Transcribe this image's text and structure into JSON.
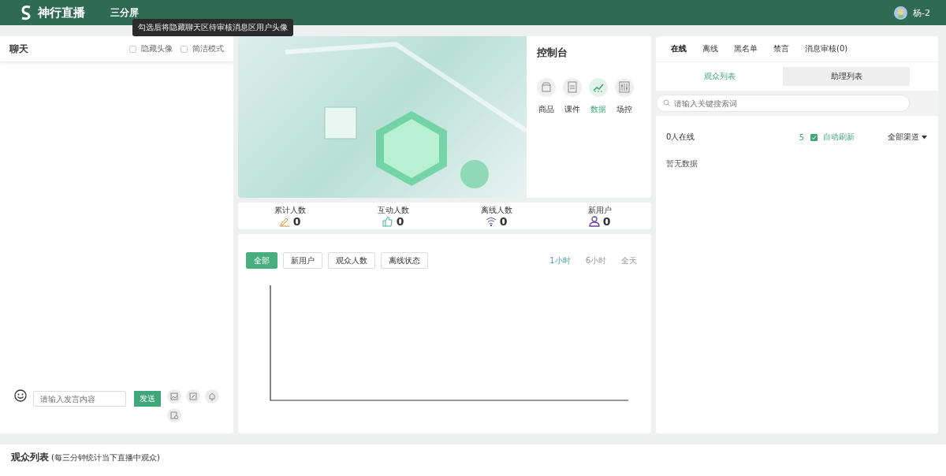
{
  "header": {
    "brand": "神行直播",
    "room_title": "三分屏",
    "user": "杨-2"
  },
  "tooltip": "勾选后将隐藏聊天区待审核消息区用户头像",
  "chat": {
    "title": "聊天",
    "options": [
      {
        "label": "隐藏头像",
        "checked": false
      },
      {
        "label": "简洁模式",
        "checked": false
      }
    ],
    "input": {
      "placeholder": "请输入发言内容"
    },
    "send": "发送"
  },
  "console": {
    "title": "控制台",
    "tools": [
      {
        "kind": "goods",
        "label": "商品",
        "selected": false
      },
      {
        "kind": "courseware",
        "label": "课件",
        "selected": false
      },
      {
        "kind": "data",
        "label": "数据",
        "selected": true
      },
      {
        "kind": "control",
        "label": "场控",
        "selected": false
      }
    ]
  },
  "stats": [
    {
      "kind": "pencil",
      "label": "累计人数",
      "value": "0"
    },
    {
      "kind": "thumb",
      "label": "互动人数",
      "value": "0"
    },
    {
      "kind": "wifi",
      "label": "离线人数",
      "value": "0"
    },
    {
      "kind": "user",
      "label": "新用户",
      "value": "0"
    }
  ],
  "chart_panel": {
    "filters": [
      {
        "label": "全部",
        "selected": true
      },
      {
        "label": "新用户",
        "selected": false
      },
      {
        "label": "观众人数",
        "selected": false
      },
      {
        "label": "离线状态",
        "selected": false
      }
    ],
    "ranges": [
      {
        "label": "1小时",
        "selected": true
      },
      {
        "label": "6小时",
        "selected": false
      },
      {
        "label": "全天",
        "selected": false
      }
    ]
  },
  "viewers": {
    "tabs": [
      {
        "label": "在线",
        "selected": true
      },
      {
        "label": "离线",
        "selected": false
      },
      {
        "label": "黑名单",
        "selected": false
      },
      {
        "label": "禁言",
        "selected": false
      },
      {
        "label": "消息审核(0)",
        "selected": false
      }
    ],
    "subtabs": [
      {
        "label": "观众列表",
        "selected": true
      },
      {
        "label": "助理列表",
        "selected": false
      }
    ],
    "search": {
      "placeholder": "请输入关键搜索词"
    },
    "online": "0人在线",
    "refresh_interval": "5",
    "auto_refresh": {
      "label": "自动刷新",
      "checked": true
    },
    "channel": "全部渠道",
    "empty": "暂无数据"
  },
  "bottom": {
    "title": "观众列表",
    "note": "(每三分钟统计当下直播中观众)"
  }
}
